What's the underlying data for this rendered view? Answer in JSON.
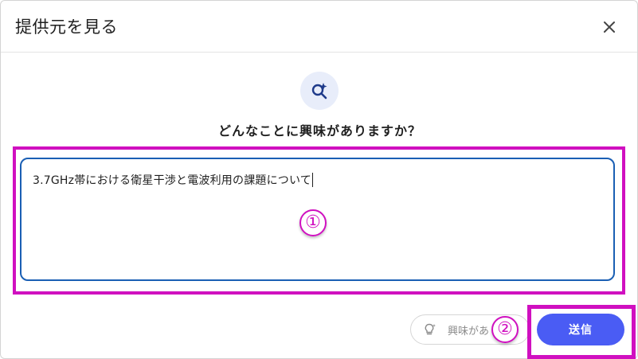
{
  "dialog": {
    "title": "提供元を見る",
    "close_icon": "close-icon"
  },
  "prompt": {
    "icon": "sparkle-search-icon",
    "question": "どんなことに興味がありますか？"
  },
  "input": {
    "value": "3.7GHz帯における衛星干渉と電波利用の課題について"
  },
  "actions": {
    "interest_label": "興味があ",
    "interest_icon": "lightbulb-icon",
    "send_label": "送信"
  },
  "annotations": {
    "marker_1": "①",
    "marker_2": "②"
  },
  "colors": {
    "accent": "#4a5cf4",
    "highlight": "#d010c0",
    "input_border": "#1a5fb4",
    "badge_bg": "#e8edfa"
  }
}
